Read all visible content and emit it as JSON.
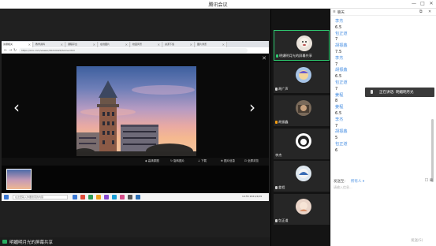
{
  "window": {
    "title": "腾讯会议",
    "min": "—",
    "max": "□",
    "close": "✕"
  },
  "browser": {
    "tabs": [
      "讲课相关",
      "教学资料",
      "课程平台",
      "在线图片",
      "校园风景",
      "资源下载",
      "图片浏览"
    ],
    "address": "https://xxx.com/viewer/20210429/home.html",
    "nav_back": "←",
    "nav_forward": "→",
    "nav_reload": "↻"
  },
  "viewer": {
    "prev": "‹",
    "next": "›",
    "close": "✕",
    "tools": [
      "◈ 高清原图",
      "↻ 旋转图片",
      "↓ 下载",
      "⊕ 图片信息",
      "⊡ 全屏浏览"
    ]
  },
  "taskbar": {
    "search_placeholder": "在这里输入你要搜索的内容",
    "clock": "14:55 2021/4/29",
    "app_colors": [
      "#3a78d4",
      "#e04b3a",
      "#2f9e57",
      "#f0a020",
      "#8a4bd1",
      "#1a9fd8",
      "#d64d8a",
      "#555555",
      "#2d6fb5"
    ]
  },
  "share_status": {
    "text": "明媚明月光的屏幕共享"
  },
  "participants": [
    {
      "name": "明媚明月光的屏幕共享",
      "active": true,
      "mic": "green",
      "avatar_color": "#e9e2da"
    },
    {
      "name": "胡广声",
      "active": false,
      "mic": "gray",
      "avatar_color": "#a7c4e6"
    },
    {
      "name": "胡振鑫",
      "active": false,
      "mic": "orange",
      "avatar_color": "#7a6a5a"
    },
    {
      "name": "李杰",
      "active": false,
      "mic": "none",
      "avatar_color": "#ffffff"
    },
    {
      "name": "姜程",
      "active": false,
      "mic": "gray",
      "avatar_color": "#dfe8f0"
    },
    {
      "name": "包正道",
      "active": false,
      "mic": "gray",
      "avatar_color": "#e9d4c8"
    }
  ],
  "chat": {
    "header": "聊天",
    "menu_icon": "≡",
    "header_controls": [
      "⧉",
      "✕"
    ],
    "messages": [
      {
        "type": "name",
        "text": "李杰"
      },
      {
        "type": "text",
        "text": "6.5"
      },
      {
        "type": "name",
        "text": "包正道"
      },
      {
        "type": "text",
        "text": "7"
      },
      {
        "type": "name",
        "text": "胡振鑫"
      },
      {
        "type": "text",
        "text": "7.5"
      },
      {
        "type": "name",
        "text": "李杰"
      },
      {
        "type": "text",
        "text": "7"
      },
      {
        "type": "name",
        "text": "胡振鑫"
      },
      {
        "type": "text",
        "text": "6.5"
      },
      {
        "type": "name",
        "text": "包正道"
      },
      {
        "type": "text",
        "text": "7"
      },
      {
        "type": "name",
        "text": "姜程"
      },
      {
        "type": "text",
        "text": "8"
      },
      {
        "type": "name",
        "text": "姜程"
      },
      {
        "type": "text",
        "text": "6.5"
      },
      {
        "type": "name",
        "text": "李杰"
      },
      {
        "type": "text",
        "text": "7"
      },
      {
        "type": "name",
        "text": "胡振鑫"
      },
      {
        "type": "text",
        "text": "5"
      },
      {
        "type": "name",
        "text": "包正道"
      },
      {
        "type": "text",
        "text": "6"
      }
    ],
    "toast": "正在讲话: 明媚明月光",
    "send_to_label": "发送至:",
    "send_to_value": "所有人 ▾",
    "send_icons": "☐ ⊠",
    "input_placeholder": "请输入信息...",
    "send_button": "发送(S)"
  }
}
